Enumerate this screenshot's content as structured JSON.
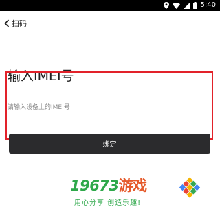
{
  "status_bar": {
    "time": "5:40",
    "icons": [
      "location-icon",
      "wifi-icon",
      "signal-icon",
      "battery-icon"
    ]
  },
  "app_bar": {
    "back_label": "扫码"
  },
  "form": {
    "heading": "输入IMEI号",
    "imei_placeholder": "请输入设备上的IMEI号",
    "imei_value": "",
    "bind_button_label": "绑定"
  },
  "watermark": {
    "brand_number": "19673",
    "brand_word": "游戏",
    "slogan": "用心分享 创造乐趣!"
  },
  "colors": {
    "status_bar": "#000000",
    "button": "#2b2b2d",
    "highlight": "#e2222a",
    "brand_green": "#2ea84a",
    "brand_orange": "#e55a2b"
  }
}
